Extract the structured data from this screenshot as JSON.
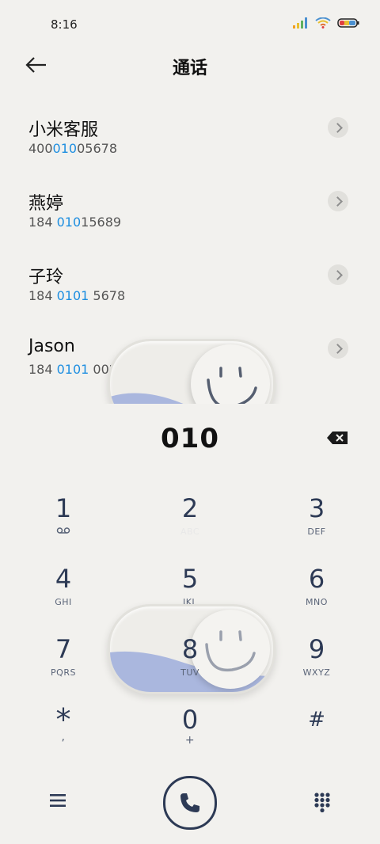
{
  "status_bar": {
    "time": "8:16"
  },
  "header": {
    "title": "通话"
  },
  "contacts": [
    {
      "name": "小米客服",
      "number_pre": "400",
      "number_hl": "010",
      "number_post": "05678"
    },
    {
      "name": "燕婷",
      "number_pre": "184 ",
      "number_hl": "010",
      "number_post": "15689"
    },
    {
      "name": "子玲",
      "number_pre": "184 ",
      "number_hl": "0101",
      "number_post": " 5678"
    },
    {
      "name": "Jason",
      "number_pre": "184 ",
      "number_hl": "0101",
      "number_post": " 0029"
    }
  ],
  "dialer": {
    "number": "010"
  },
  "keypad": [
    {
      "digit": "1",
      "letters": ""
    },
    {
      "digit": "2",
      "letters": "ABC"
    },
    {
      "digit": "3",
      "letters": "DEF"
    },
    {
      "digit": "4",
      "letters": "GHI"
    },
    {
      "digit": "5",
      "letters": "JKL"
    },
    {
      "digit": "6",
      "letters": "MNO"
    },
    {
      "digit": "7",
      "letters": "PQRS"
    },
    {
      "digit": "8",
      "letters": "TUV"
    },
    {
      "digit": "9",
      "letters": "WXYZ"
    },
    {
      "digit": "*",
      "letters": ","
    },
    {
      "digit": "0",
      "letters": "+"
    },
    {
      "digit": "#",
      "letters": ""
    }
  ],
  "icons": {
    "back": "arrow-left-icon",
    "signal": "signal-icon",
    "wifi": "wifi-icon",
    "battery": "battery-icon",
    "voicemail": "voicemail-icon",
    "backspace": "backspace-icon",
    "menu": "menu-icon",
    "call": "phone-icon",
    "dialpad": "dialpad-icon"
  },
  "colors": {
    "highlight": "#1d8ee0",
    "keypad_text": "#2d3a55",
    "background": "#f2f1ee"
  }
}
